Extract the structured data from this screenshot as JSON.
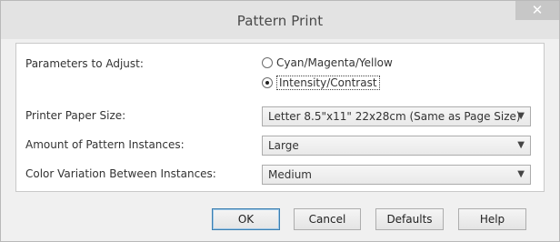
{
  "window": {
    "title": "Pattern Print",
    "close_symbol": "✕"
  },
  "form": {
    "parameters_label": "Parameters to Adjust:",
    "radio_options": [
      {
        "label": "Cyan/Magenta/Yellow",
        "selected": false
      },
      {
        "label": "Intensity/Contrast",
        "selected": true
      }
    ],
    "paper_size": {
      "label": "Printer Paper Size:",
      "value": "Letter 8.5\"x11\" 22x28cm (Same as Page Size)"
    },
    "instances": {
      "label": "Amount of Pattern Instances:",
      "value": "Large"
    },
    "variation": {
      "label": "Color Variation Between Instances:",
      "value": "Medium"
    }
  },
  "buttons": {
    "ok": "OK",
    "cancel": "Cancel",
    "defaults": "Defaults",
    "help": "Help"
  },
  "icons": {
    "dropdown": "chevron-down-icon",
    "close": "close-icon"
  }
}
